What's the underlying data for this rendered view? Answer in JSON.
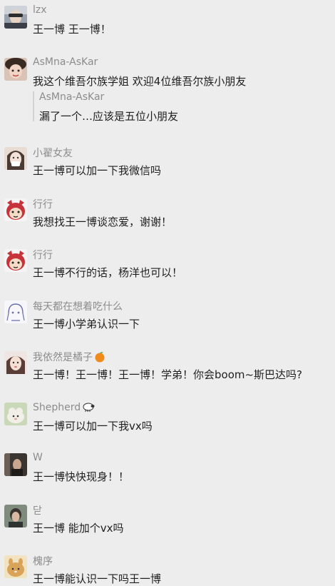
{
  "comments": [
    {
      "name": "lzx",
      "text": "王一博 王一博！"
    },
    {
      "name": "AsMna-AsKar",
      "text": "我这个维吾尔族学姐 欢迎4位维吾尔族小朋友",
      "reply": {
        "name": "AsMna-AsKar",
        "text": "漏了一个…应该是五位小朋友"
      }
    },
    {
      "name": "小翟女友",
      "text": "王一博可以加一下我微信吗"
    },
    {
      "name": "行行",
      "text": "我想找王一博谈恋爱，谢谢！"
    },
    {
      "name": "行行",
      "text": "王一博不行的话，杨洋也可以！"
    },
    {
      "name": "每天都在想着吃什么",
      "text": "王一博小学弟认识一下"
    },
    {
      "name": "我依然是橘子",
      "name_emoji": "tangerine-emoji",
      "text": "王一博！王一博！王一博！学弟！你会boom~斯巴达吗?"
    },
    {
      "name": "Shepherd",
      "name_emoji": "sheep-emoji",
      "text": "王一博可以加一下我vx吗"
    },
    {
      "name": "W",
      "text": "王一博快快现身！！"
    },
    {
      "name": "닫",
      "text": "王一博 能加个vx吗"
    },
    {
      "name": "槐序",
      "text": "王一博能认识一下吗王一博"
    }
  ],
  "colors": {
    "background": "#ededed",
    "name": "#8c8c8c",
    "text": "#1f1f1f",
    "reply_bar": "#d2d2d2"
  }
}
